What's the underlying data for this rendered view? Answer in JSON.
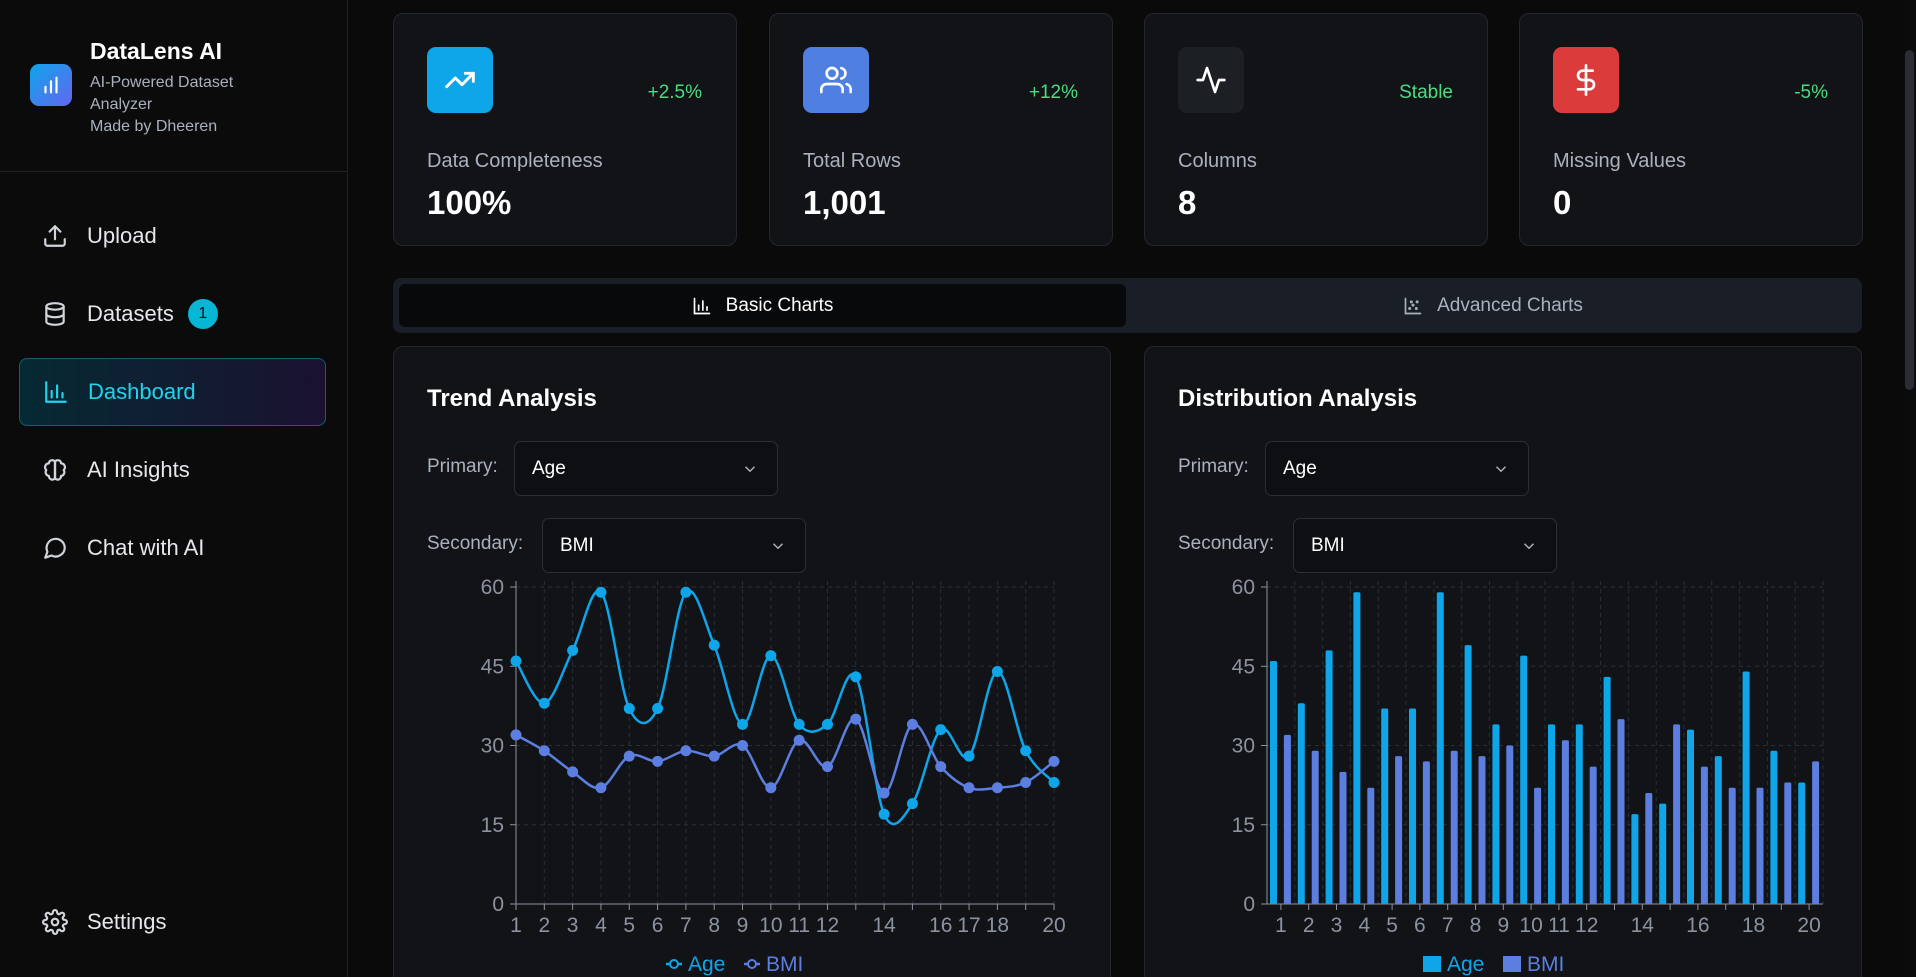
{
  "brand": {
    "title": "DataLens AI",
    "subtitle": "AI-Powered Dataset Analyzer",
    "credit": "Made by Dheeren"
  },
  "nav": {
    "upload": "Upload",
    "datasets": "Datasets",
    "datasets_badge": "1",
    "dashboard": "Dashboard",
    "ai_insights": "AI Insights",
    "chat": "Chat with AI",
    "settings": "Settings"
  },
  "stats": [
    {
      "label": "Data Completeness",
      "value": "100%",
      "change": "+2.5%",
      "icon": "trending-up-icon",
      "color": "#0ea5e9"
    },
    {
      "label": "Total Rows",
      "value": "1,001",
      "change": "+12%",
      "icon": "users-icon",
      "color": "#4f7fe0"
    },
    {
      "label": "Columns",
      "value": "8",
      "change": "Stable",
      "icon": "activity-icon",
      "color": "#1c1f24"
    },
    {
      "label": "Missing Values",
      "value": "0",
      "change": "-5%",
      "icon": "dollar-icon",
      "color": "#dc3b3b"
    }
  ],
  "tabs": {
    "basic": "Basic Charts",
    "advanced": "Advanced Charts"
  },
  "panels": {
    "trend": {
      "title": "Trend Analysis",
      "primary_label": "Primary:",
      "primary_value": "Age",
      "secondary_label": "Secondary:",
      "secondary_value": "BMI"
    },
    "distribution": {
      "title": "Distribution Analysis",
      "primary_label": "Primary:",
      "primary_value": "Age",
      "secondary_label": "Secondary:",
      "secondary_value": "BMI"
    }
  },
  "colors": {
    "age": "#0ea5e9",
    "bmi": "#5b7ee0",
    "positive": "#4ade80",
    "accent": "#22d3ee"
  },
  "chart_data": [
    {
      "type": "line",
      "title": "Trend Analysis",
      "x": [
        1,
        2,
        3,
        4,
        5,
        6,
        7,
        8,
        9,
        10,
        11,
        12,
        13,
        14,
        15,
        16,
        17,
        18,
        19,
        20
      ],
      "x_tick_labels": [
        "1",
        "2",
        "3",
        "4",
        "5",
        "6",
        "7",
        "8",
        "9",
        "10",
        "11",
        "12",
        "",
        "14",
        "",
        "16",
        "17",
        "18",
        "",
        "20"
      ],
      "yticks": [
        0,
        15,
        30,
        45,
        60
      ],
      "ylim": [
        0,
        60
      ],
      "grid": true,
      "legend": "bottom",
      "series": [
        {
          "name": "Age",
          "values": [
            46,
            38,
            48,
            59,
            37,
            37,
            59,
            49,
            34,
            47,
            34,
            34,
            43,
            17,
            19,
            33,
            28,
            44,
            29,
            23
          ]
        },
        {
          "name": "BMI",
          "values": [
            32,
            29,
            25,
            22,
            28,
            27,
            29,
            28,
            30,
            22,
            31,
            26,
            35,
            21,
            34,
            26,
            22,
            22,
            23,
            27
          ]
        }
      ]
    },
    {
      "type": "bar",
      "title": "Distribution Analysis",
      "x": [
        1,
        2,
        3,
        4,
        5,
        6,
        7,
        8,
        9,
        10,
        11,
        12,
        13,
        14,
        15,
        16,
        17,
        18,
        19,
        20
      ],
      "x_tick_labels": [
        "1",
        "2",
        "3",
        "4",
        "5",
        "6",
        "7",
        "8",
        "9",
        "10",
        "11",
        "12",
        "",
        "14",
        "",
        "16",
        "",
        "18",
        "",
        "20"
      ],
      "yticks": [
        0,
        15,
        30,
        45,
        60
      ],
      "ylim": [
        0,
        60
      ],
      "grid": true,
      "legend": "bottom",
      "series": [
        {
          "name": "Age",
          "values": [
            46,
            38,
            48,
            59,
            37,
            37,
            59,
            49,
            34,
            47,
            34,
            34,
            43,
            17,
            19,
            33,
            28,
            44,
            29,
            23
          ]
        },
        {
          "name": "BMI",
          "values": [
            32,
            29,
            25,
            22,
            28,
            27,
            29,
            28,
            30,
            22,
            31,
            26,
            35,
            21,
            34,
            26,
            22,
            22,
            23,
            27
          ]
        }
      ]
    }
  ]
}
